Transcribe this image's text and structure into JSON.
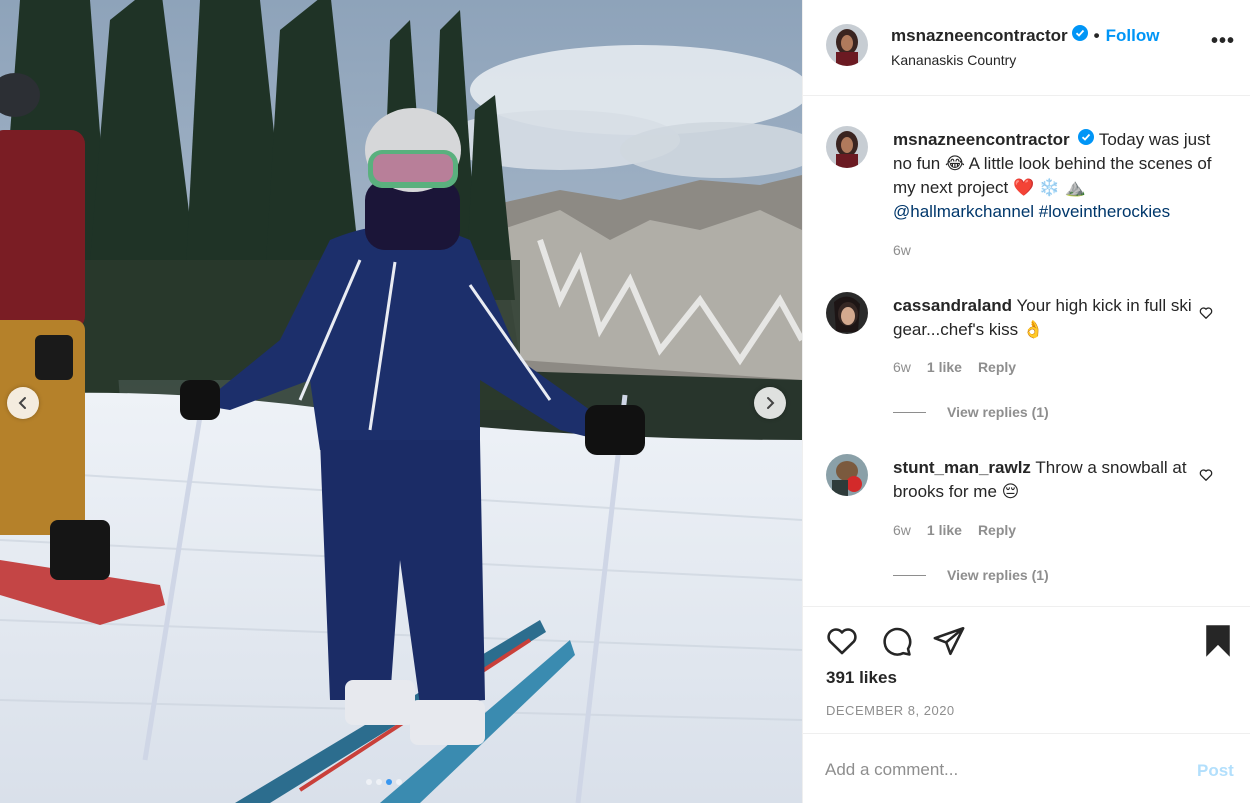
{
  "photo": {
    "prev_icon": "chevron-left-icon",
    "next_icon": "chevron-right-icon",
    "carousel_count": 4,
    "carousel_active": 3
  },
  "header": {
    "username": "msnazneencontractor",
    "separator": "•",
    "follow_label": "Follow",
    "location": "Kananaskis Country",
    "more_label": "•••"
  },
  "caption": {
    "username": "msnazneencontractor",
    "text": "Today was just no fun 😂 A little look behind the scenes of my next project ❤️ ❄️ ⛰️",
    "mention": "@hallmarkchannel",
    "hashtag": "#loveintherockies",
    "time": "6w"
  },
  "comments": [
    {
      "username": "cassandraland",
      "text": "Your high kick in full ski gear...chef's kiss 👌",
      "time": "6w",
      "likes": "1 like",
      "reply_label": "Reply",
      "view_replies": "View replies (1)"
    },
    {
      "username": "stunt_man_rawlz",
      "text": "Throw a snowball at brooks for me 😔",
      "time": "6w",
      "likes": "1 like",
      "reply_label": "Reply",
      "view_replies": "View replies (1)"
    }
  ],
  "actions": {
    "likes": "391 likes",
    "date": "DECEMBER 8, 2020"
  },
  "add_comment": {
    "placeholder": "Add a comment...",
    "post_label": "Post"
  },
  "colors": {
    "accent": "#0095f6",
    "post_disabled": "#b2dffc",
    "muted": "#8e8e8e",
    "link": "#00376b"
  }
}
